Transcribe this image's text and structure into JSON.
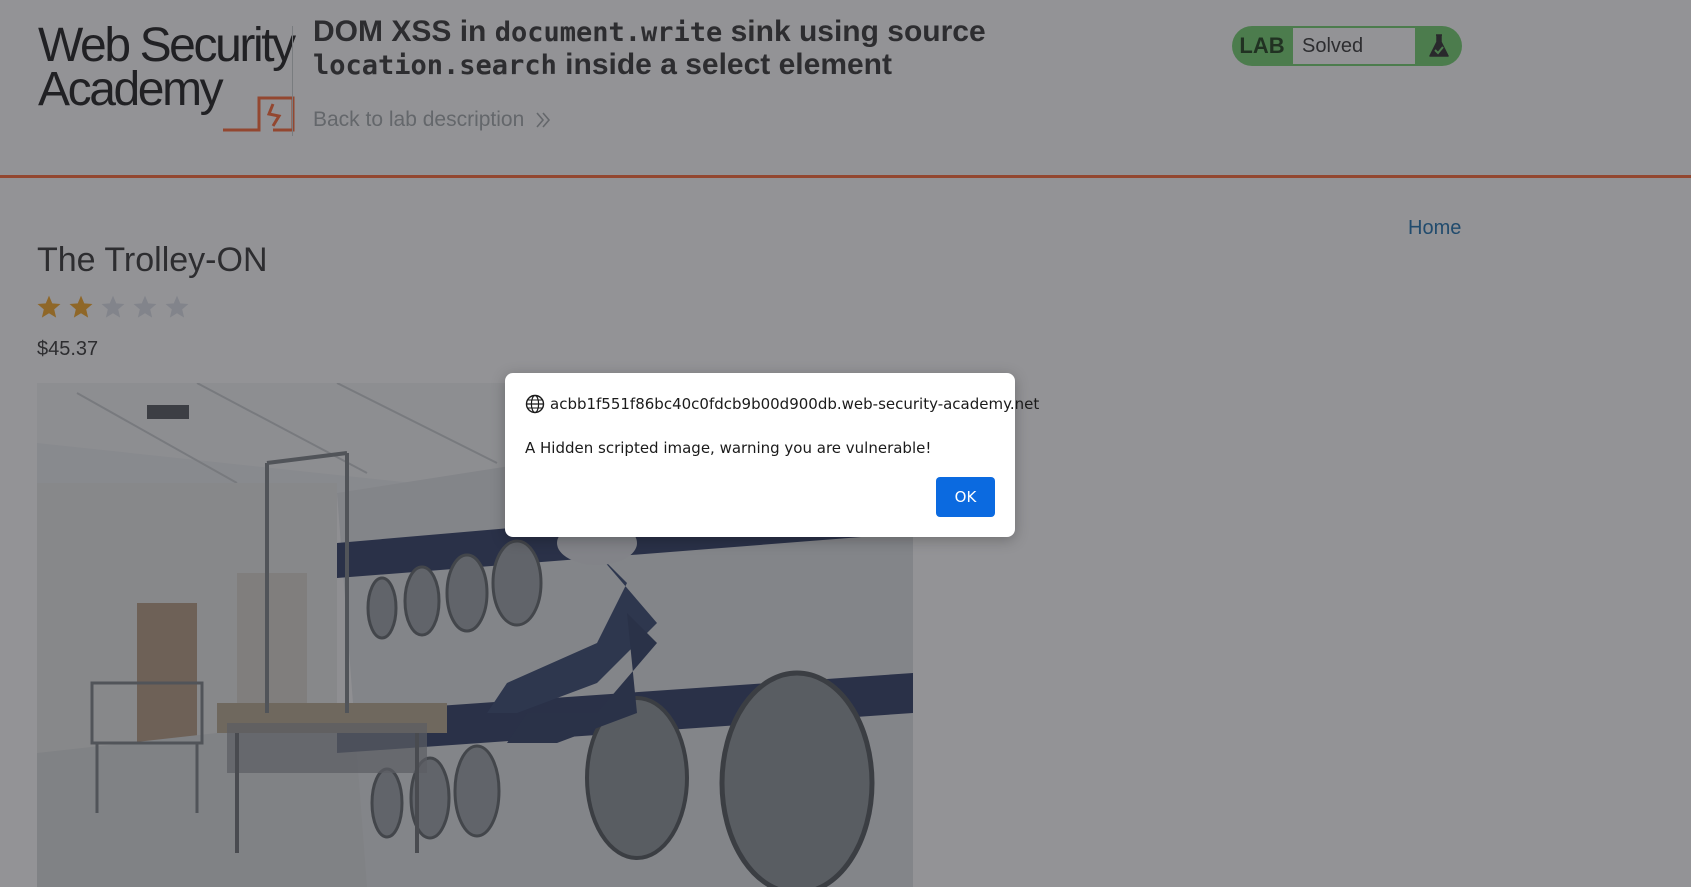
{
  "header": {
    "logo": {
      "line1": "Web Security",
      "line2": "Academy"
    },
    "lab_title_prefix": "DOM XSS in ",
    "lab_title_code1": "document.write",
    "lab_title_mid": " sink using source ",
    "lab_title_code2": "location.search",
    "lab_title_suffix": " inside a select element",
    "back_link": "Back to lab description",
    "lab_badge": "LAB",
    "lab_status": "Solved",
    "colors": {
      "accent": "#ff6633",
      "solved_green": "#70d16d"
    }
  },
  "nav": {
    "home": "Home"
  },
  "product": {
    "title": "The Trolley-ON",
    "rating": 2,
    "rating_max": 5,
    "price": "$45.37",
    "image_icon": "laundromat-photo"
  },
  "dialog": {
    "origin": "acbb1f551f86bc40c0fdcb9b00d900db.web-security-academy.net",
    "message": "A Hidden scripted image, warning you are vulnerable!",
    "ok_label": "OK",
    "origin_icon": "globe-icon"
  }
}
